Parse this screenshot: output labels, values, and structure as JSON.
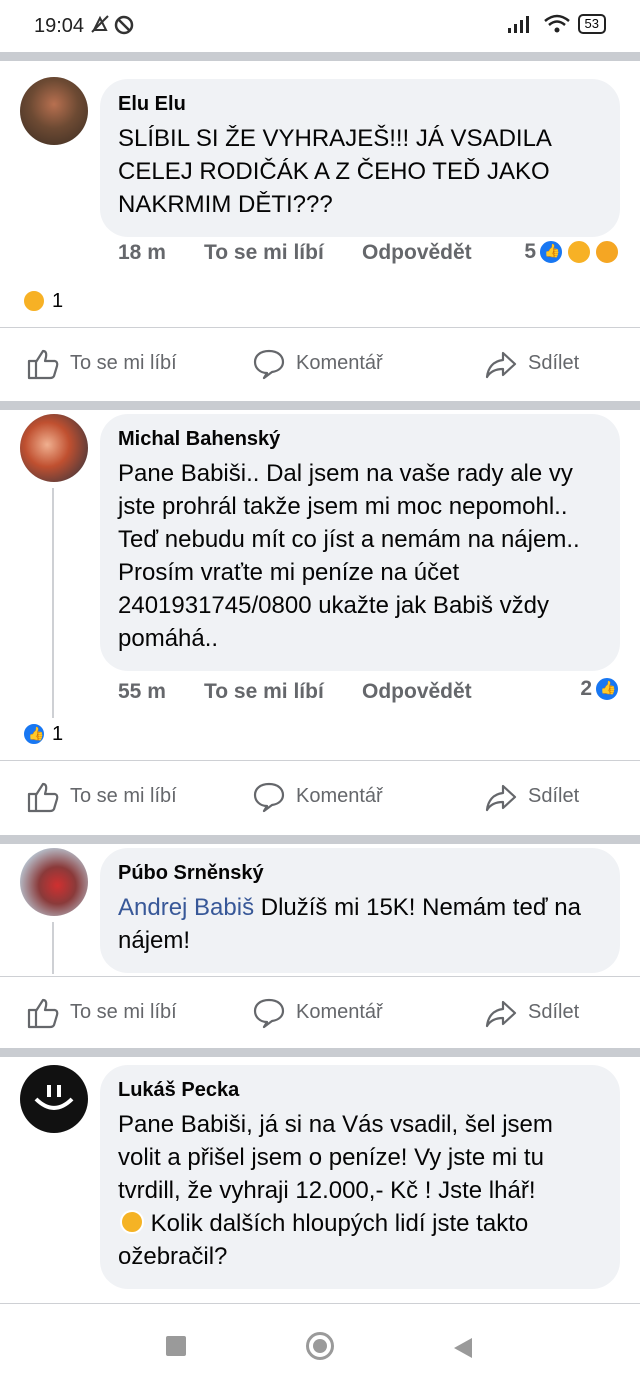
{
  "status_bar": {
    "time": "19:04",
    "battery": "53"
  },
  "comments": [
    {
      "author": "Elu Elu",
      "text": "SLÍBIL SI ŽE VYHRAJEŠ!!! JÁ VSADILA CELEJ RODIČÁK A Z ČEHO TEĎ JAKO NAKRMIM DĚTI???",
      "time": "18 m",
      "like_label": "To se mi líbí",
      "reply_label": "Odpovědět",
      "reaction_count": "5",
      "post_reaction_count": "1"
    },
    {
      "author": "Michal Bahenský",
      "text": "Pane Babiši.. Dal jsem na vaše rady ale vy jste prohrál takže jsem mi moc nepomohl.. Teď nebudu mít co jíst a nemám na nájem.. Prosím vraťte mi peníze na účet 2401931745/0800 ukažte jak Babiš vždy pomáhá..",
      "time": "55 m",
      "like_label": "To se mi líbí",
      "reply_label": "Odpovědět",
      "reaction_count": "2",
      "post_reaction_count": "1"
    },
    {
      "author": "Púbo Srněnský",
      "tag": "Andrej Babiš",
      "text": "Dlužíš mi 15K! Nemám teď na nájem!"
    },
    {
      "author": "Lukáš Pecka",
      "text_part1": "Pane Babiši, já si na Vás vsadil, šel jsem volit a přišel jsem o peníze! Vy jste mi tu tvrdill, že vyhraji 12.000,- Kč ! Jste lhář!",
      "text_part2": "Kolik dalších hloupých lidí jste takto ožebračil?"
    }
  ],
  "actions": {
    "like": "To se mi líbí",
    "comment": "Komentář",
    "share": "Sdílet"
  }
}
